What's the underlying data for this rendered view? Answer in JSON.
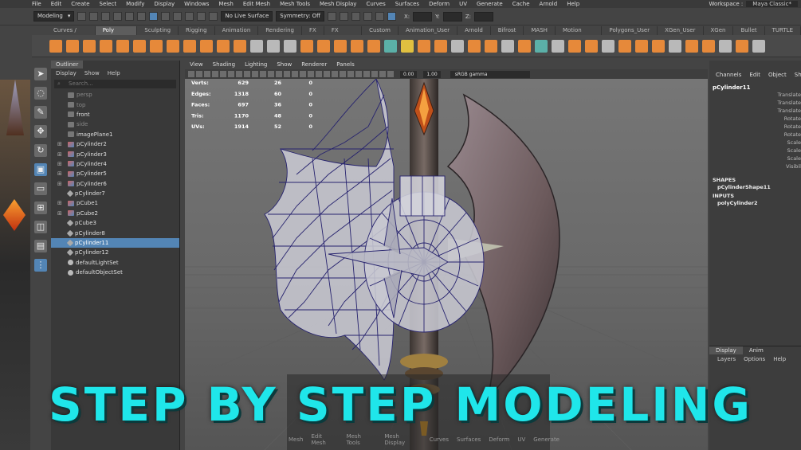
{
  "menubar": {
    "items": [
      "File",
      "Edit",
      "Create",
      "Select",
      "Modify",
      "Display",
      "Windows",
      "Mesh",
      "Edit Mesh",
      "Mesh Tools",
      "Mesh Display",
      "Curves",
      "Surfaces",
      "Deform",
      "UV",
      "Generate",
      "Cache",
      "Arnold",
      "Help"
    ],
    "workspace_label": "Workspace :",
    "workspace_value": "Maya Classic*"
  },
  "statusline": {
    "mode": "Modeling",
    "live_surface": "No Live Surface",
    "symmetry": "Symmetry: Off",
    "x_label": "X:",
    "y_label": "Y:",
    "z_label": "Z:"
  },
  "shelf_tabs": [
    "Curves / Surfaces",
    "Poly Modeling",
    "Sculpting",
    "Rigging",
    "Animation",
    "Rendering",
    "FX",
    "FX Caching",
    "Custom",
    "Animation_User",
    "Arnold",
    "Bifrost",
    "MASH",
    "Motion Graphics",
    "Polygons_User",
    "XGen_User",
    "XGen",
    "Bullet",
    "TURTLE"
  ],
  "shelf_active": 1,
  "outliner": {
    "title": "Outliner",
    "menu": [
      "Display",
      "Show",
      "Help"
    ],
    "search_placeholder": "Search...",
    "items": [
      {
        "label": "persp",
        "type": "camera",
        "dim": true
      },
      {
        "label": "top",
        "type": "camera",
        "dim": true
      },
      {
        "label": "front",
        "type": "camera",
        "dim": false
      },
      {
        "label": "side",
        "type": "camera",
        "dim": true
      },
      {
        "label": "imagePlane1",
        "type": "camera",
        "dim": false
      },
      {
        "label": "pCylinder2",
        "type": "mesh",
        "expand": true
      },
      {
        "label": "pCylinder3",
        "type": "mesh",
        "expand": true
      },
      {
        "label": "pCylinder4",
        "type": "mesh",
        "expand": true
      },
      {
        "label": "pCylinder5",
        "type": "mesh",
        "expand": true
      },
      {
        "label": "pCylinder6",
        "type": "mesh",
        "expand": true
      },
      {
        "label": "pCylinder7",
        "type": "node"
      },
      {
        "label": "pCube1",
        "type": "mesh",
        "expand": true
      },
      {
        "label": "pCube2",
        "type": "mesh",
        "expand": true
      },
      {
        "label": "pCube3",
        "type": "node"
      },
      {
        "label": "pCylinder8",
        "type": "node"
      },
      {
        "label": "pCylinder11",
        "type": "node",
        "selected": true
      },
      {
        "label": "pCylinder12",
        "type": "node"
      },
      {
        "label": "defaultLightSet",
        "type": "set"
      },
      {
        "label": "defaultObjectSet",
        "type": "set"
      }
    ]
  },
  "viewport": {
    "menu": [
      "View",
      "Shading",
      "Lighting",
      "Show",
      "Renderer",
      "Panels"
    ],
    "exposure": "0.00",
    "gamma": "1.00",
    "colorspace": "sRGB gamma",
    "hud": [
      {
        "label": "Verts:",
        "a": "629",
        "b": "26",
        "c": "0"
      },
      {
        "label": "Edges:",
        "a": "1318",
        "b": "60",
        "c": "0"
      },
      {
        "label": "Faces:",
        "a": "697",
        "b": "36",
        "c": "0"
      },
      {
        "label": "Tris:",
        "a": "1170",
        "b": "48",
        "c": "0"
      },
      {
        "label": "UVs:",
        "a": "1914",
        "b": "52",
        "c": "0"
      }
    ]
  },
  "channels": {
    "menu": [
      "Channels",
      "Edit",
      "Object",
      "Show"
    ],
    "object": "pCylinder11",
    "attrs": [
      "Translate",
      "Translate",
      "Translate",
      "Rotate",
      "Rotate",
      "Rotate",
      "Scale",
      "Scale",
      "Scale",
      "Visibil"
    ],
    "shapes_label": "SHAPES",
    "shape": "pCylinderShape11",
    "inputs_label": "INPUTS",
    "input": "polyCylinder2"
  },
  "layers": {
    "tabs": [
      "Display",
      "Anim"
    ],
    "menu": [
      "Layers",
      "Options",
      "Help"
    ]
  },
  "marking_menu": [
    "Mesh",
    "Edit Mesh",
    "Mesh Tools",
    "Mesh Display",
    "Curves",
    "Surfaces",
    "Deform",
    "UV",
    "Generate"
  ],
  "headline": "STEP BY STEP MODELING"
}
